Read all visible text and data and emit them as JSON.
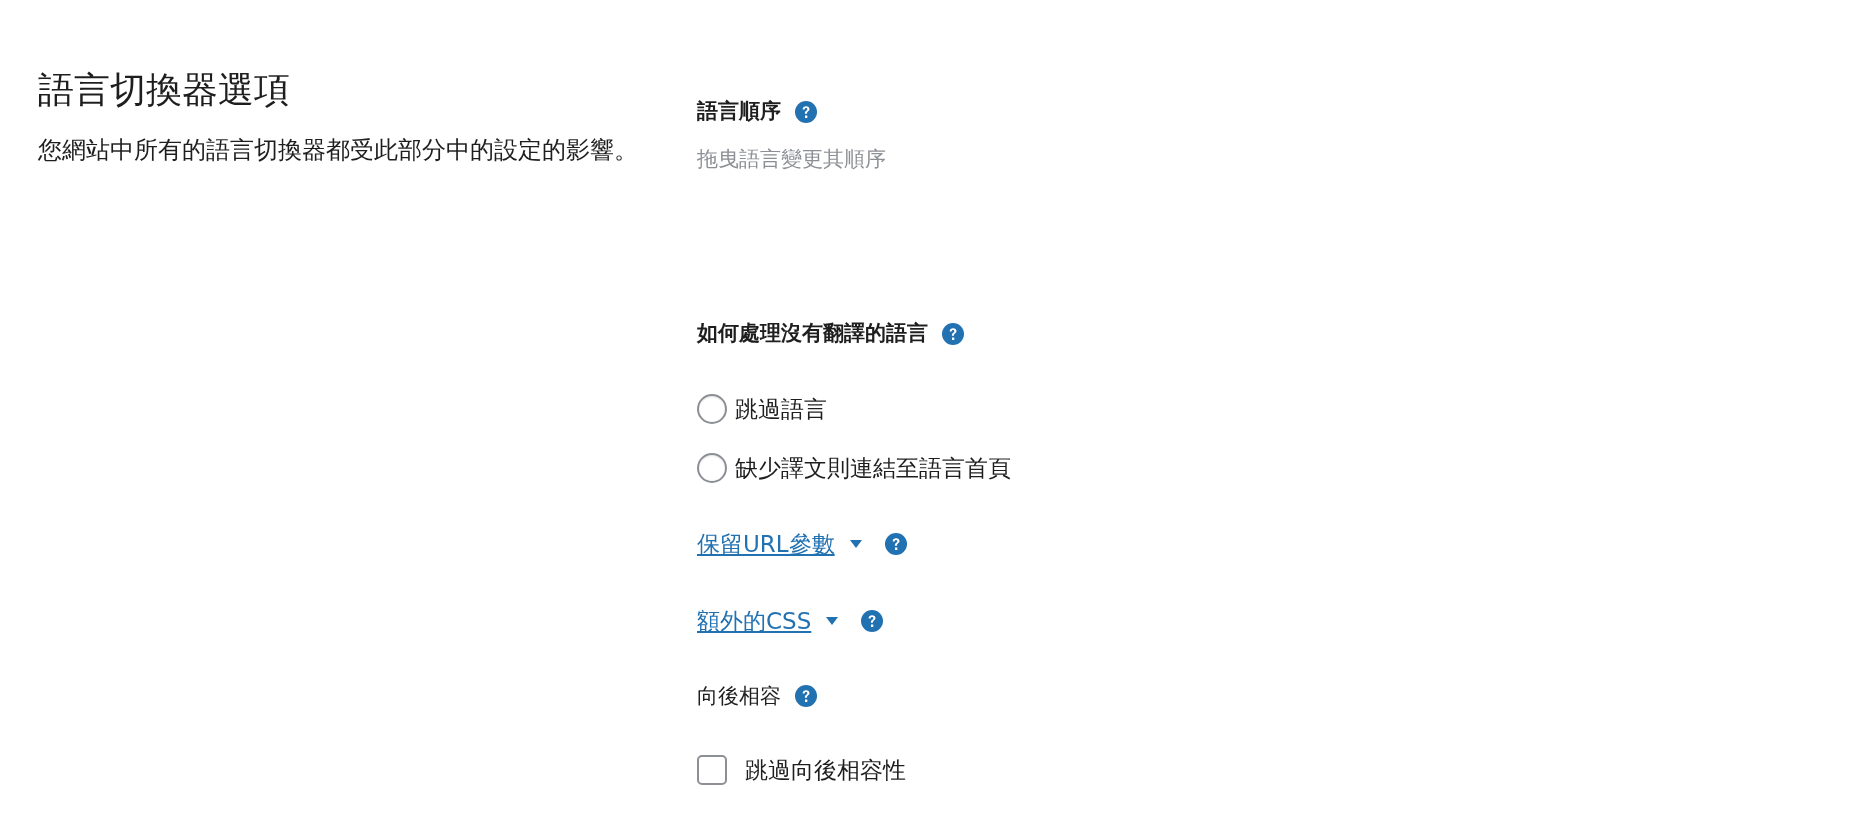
{
  "intro": {
    "title": "語言切換器選項",
    "description": "您網站中所有的語言切換器都受此部分中的設定的影響。"
  },
  "settings": [
    {
      "kind": "heading",
      "label": "語言順序",
      "help": true,
      "hint": "拖曳語言變更其順序"
    },
    {
      "kind": "radio-group",
      "label": "如何處理沒有翻譯的語言",
      "help": true,
      "options": [
        {
          "label": "跳過語言",
          "selected": false
        },
        {
          "label": "缺少譯文則連結至語言首頁",
          "selected": false
        }
      ]
    },
    {
      "kind": "toggle-link",
      "label": "保留URL參數",
      "help": true,
      "expanded": false
    },
    {
      "kind": "toggle-link",
      "label": "額外的CSS",
      "help": true,
      "expanded": false
    },
    {
      "kind": "checkbox-group",
      "label": "向後相容",
      "help": true,
      "options": [
        {
          "label": "跳過向後相容性",
          "checked": false
        }
      ]
    }
  ]
}
